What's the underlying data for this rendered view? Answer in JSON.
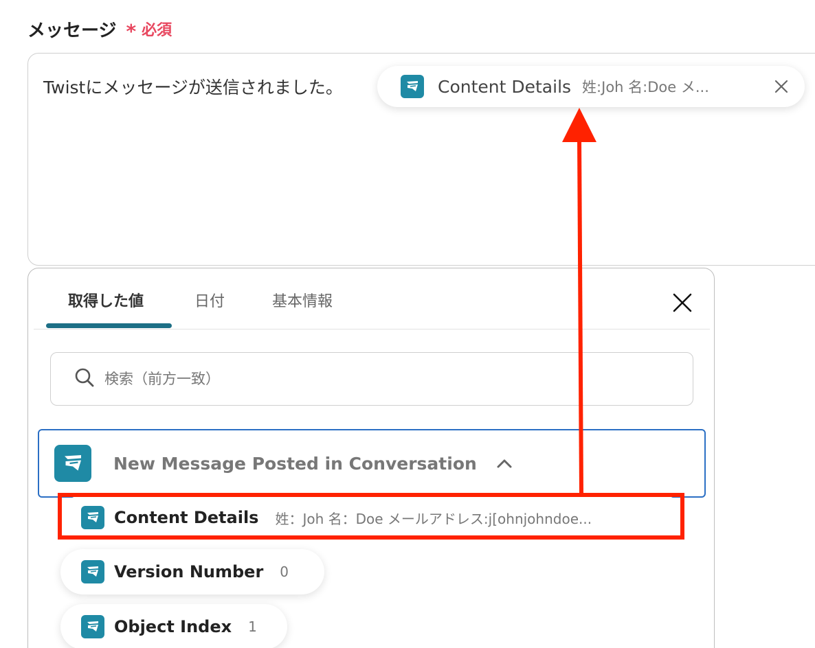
{
  "field": {
    "label": "メッセージ",
    "required_star": "*",
    "required_text": "必須"
  },
  "message": {
    "text": "Twistにメッセージが送信されました。",
    "chip": {
      "icon": "twist-app-icon",
      "name": "Content Details",
      "value": "姓:Joh 名:Doe メ..."
    }
  },
  "panel": {
    "tabs": [
      {
        "label": "取得した値",
        "active": true
      },
      {
        "label": "日付",
        "active": false
      },
      {
        "label": "基本情報",
        "active": false
      }
    ],
    "search": {
      "placeholder": "検索（前方一致）"
    },
    "group": {
      "icon": "twist-app-icon",
      "title": "New Message Posted in Conversation",
      "expanded": true
    },
    "items": [
      {
        "name": "Content Details",
        "value": "姓：Joh 名：Doe メールアドレス:j[ohnjohndoe..."
      },
      {
        "name": "Version Number",
        "value": "0"
      },
      {
        "name": "Object Index",
        "value": "1"
      }
    ]
  },
  "colors": {
    "accent": "#1d6f86",
    "app_icon": "#1f8aa5",
    "required": "#e8475f",
    "annotation": "#ff2200",
    "group_border": "#2b6fc4"
  }
}
